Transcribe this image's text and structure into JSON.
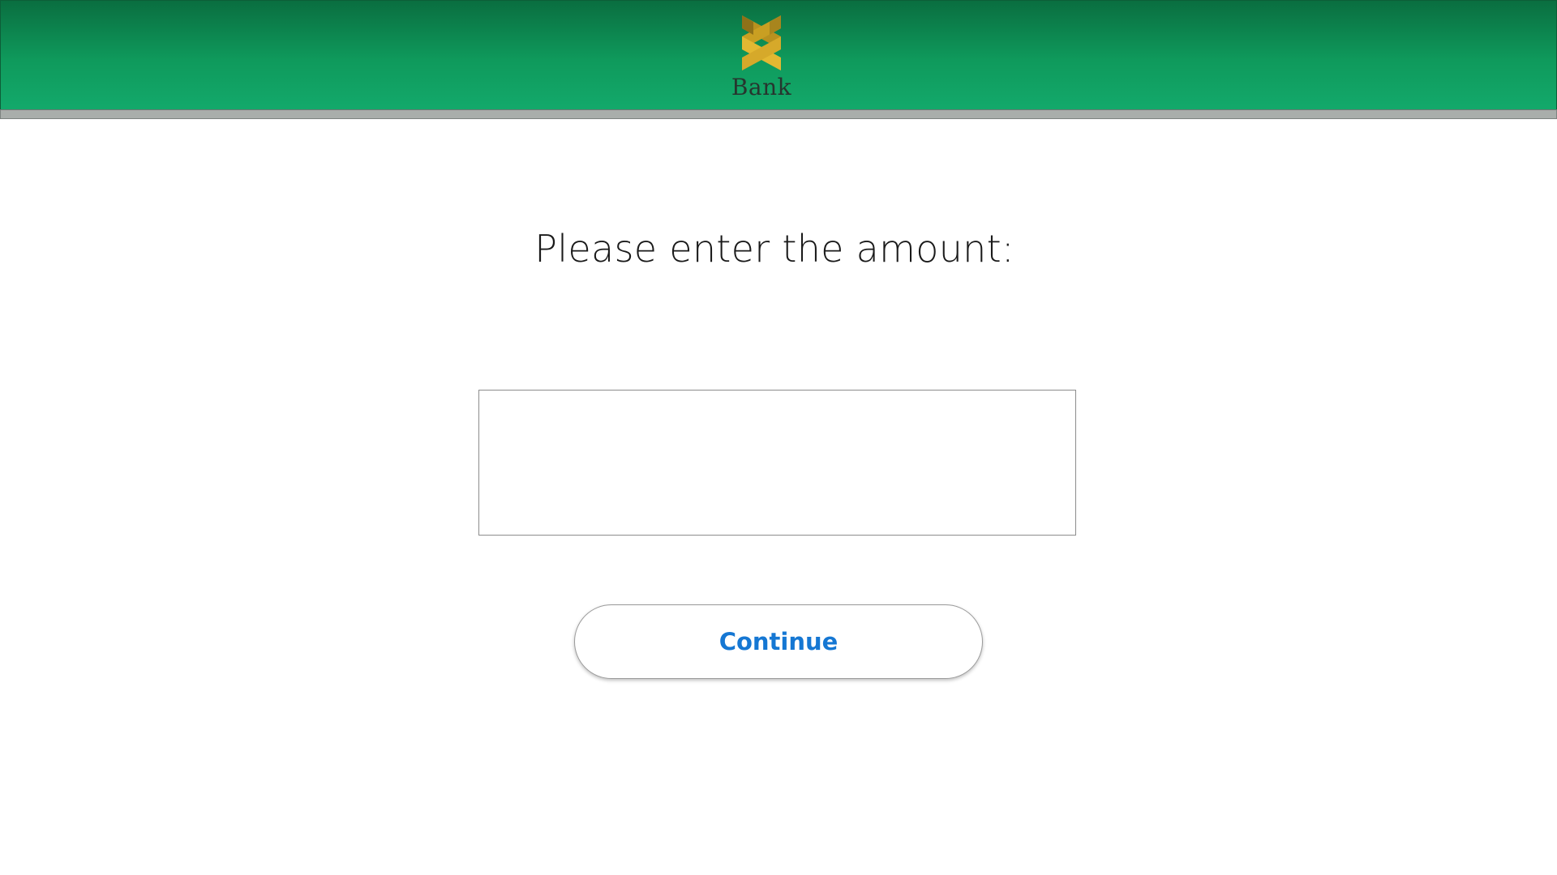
{
  "header": {
    "logo_icon": "bank-ribbon-logo-icon",
    "logo_text": "Bank",
    "colors": {
      "gradient_top": "#0a6e40",
      "gradient_bottom": "#13a96b",
      "accent_gold": "#e3b832"
    }
  },
  "main": {
    "prompt": "Please enter the amount:",
    "amount_value": "",
    "continue_label": "Continue",
    "colors": {
      "button_text": "#1577d3"
    }
  }
}
